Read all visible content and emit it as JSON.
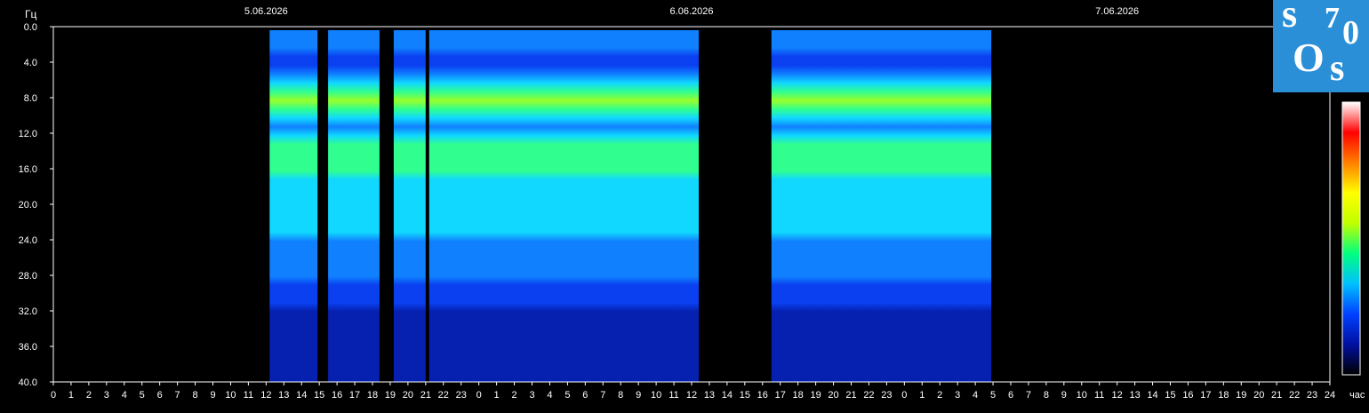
{
  "chart_data": {
    "type": "heatmap",
    "title": "",
    "ylabel": "Гц",
    "xlabel": "час",
    "ylim": [
      0,
      40
    ],
    "y_ticks": [
      "0.0",
      "4.0",
      "8.0",
      "12.0",
      "16.0",
      "20.0",
      "24.0",
      "28.0",
      "32.0",
      "36.0",
      "40.0"
    ],
    "x_hour_ticks": [
      "0",
      "1",
      "2",
      "3",
      "4",
      "5",
      "6",
      "7",
      "8",
      "9",
      "10",
      "11",
      "12",
      "13",
      "14",
      "15",
      "16",
      "17",
      "18",
      "19",
      "20",
      "21",
      "22",
      "23",
      "0",
      "1",
      "2",
      "3",
      "4",
      "5",
      "6",
      "7",
      "8",
      "9",
      "10",
      "11",
      "12",
      "13",
      "14",
      "15",
      "16",
      "17",
      "18",
      "19",
      "20",
      "21",
      "22",
      "23",
      "0",
      "1",
      "2",
      "3",
      "4",
      "5",
      "6",
      "7",
      "8",
      "9",
      "10",
      "11",
      "12",
      "13",
      "14",
      "15",
      "16",
      "17",
      "18",
      "19",
      "20",
      "21",
      "22",
      "23",
      "24"
    ],
    "dates": [
      "5.06.2026",
      "6.06.2026",
      "7.06.2026"
    ],
    "data_intervals_hours": [
      [
        12.2,
        14.9
      ],
      [
        15.5,
        18.4
      ],
      [
        19.2,
        21.0
      ],
      [
        21.2,
        36.4
      ],
      [
        40.5,
        52.9
      ]
    ],
    "resonance_bands_hz": [
      7.8,
      14.3,
      20.0,
      26.0
    ],
    "colorscale": [
      "#000000",
      "#0010a0",
      "#0040ff",
      "#00c0ff",
      "#00ff80",
      "#c0ff00",
      "#ffff00",
      "#ff8000",
      "#ff0000",
      "#ffffff"
    ]
  },
  "logo": {
    "text_s1": "s",
    "text_7": "7",
    "text_0": "0",
    "text_o": "O",
    "text_s2": "s"
  }
}
